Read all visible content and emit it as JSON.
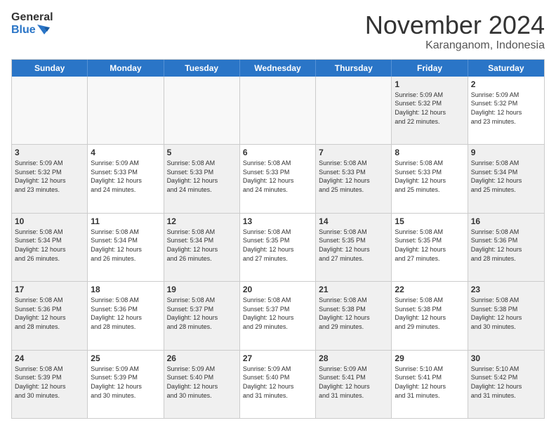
{
  "logo": {
    "line1": "General",
    "line2": "Blue"
  },
  "title": "November 2024",
  "location": "Karanganom, Indonesia",
  "days_header": [
    "Sunday",
    "Monday",
    "Tuesday",
    "Wednesday",
    "Thursday",
    "Friday",
    "Saturday"
  ],
  "weeks": [
    [
      {
        "day": "",
        "text": "",
        "empty": true
      },
      {
        "day": "",
        "text": "",
        "empty": true
      },
      {
        "day": "",
        "text": "",
        "empty": true
      },
      {
        "day": "",
        "text": "",
        "empty": true
      },
      {
        "day": "",
        "text": "",
        "empty": true
      },
      {
        "day": "1",
        "text": "Sunrise: 5:09 AM\nSunset: 5:32 PM\nDaylight: 12 hours\nand 22 minutes.",
        "shaded": true
      },
      {
        "day": "2",
        "text": "Sunrise: 5:09 AM\nSunset: 5:32 PM\nDaylight: 12 hours\nand 23 minutes.",
        "shaded": false
      }
    ],
    [
      {
        "day": "3",
        "text": "Sunrise: 5:09 AM\nSunset: 5:32 PM\nDaylight: 12 hours\nand 23 minutes.",
        "shaded": true
      },
      {
        "day": "4",
        "text": "Sunrise: 5:09 AM\nSunset: 5:33 PM\nDaylight: 12 hours\nand 24 minutes.",
        "shaded": false
      },
      {
        "day": "5",
        "text": "Sunrise: 5:08 AM\nSunset: 5:33 PM\nDaylight: 12 hours\nand 24 minutes.",
        "shaded": true
      },
      {
        "day": "6",
        "text": "Sunrise: 5:08 AM\nSunset: 5:33 PM\nDaylight: 12 hours\nand 24 minutes.",
        "shaded": false
      },
      {
        "day": "7",
        "text": "Sunrise: 5:08 AM\nSunset: 5:33 PM\nDaylight: 12 hours\nand 25 minutes.",
        "shaded": true
      },
      {
        "day": "8",
        "text": "Sunrise: 5:08 AM\nSunset: 5:33 PM\nDaylight: 12 hours\nand 25 minutes.",
        "shaded": false
      },
      {
        "day": "9",
        "text": "Sunrise: 5:08 AM\nSunset: 5:34 PM\nDaylight: 12 hours\nand 25 minutes.",
        "shaded": true
      }
    ],
    [
      {
        "day": "10",
        "text": "Sunrise: 5:08 AM\nSunset: 5:34 PM\nDaylight: 12 hours\nand 26 minutes.",
        "shaded": true
      },
      {
        "day": "11",
        "text": "Sunrise: 5:08 AM\nSunset: 5:34 PM\nDaylight: 12 hours\nand 26 minutes.",
        "shaded": false
      },
      {
        "day": "12",
        "text": "Sunrise: 5:08 AM\nSunset: 5:34 PM\nDaylight: 12 hours\nand 26 minutes.",
        "shaded": true
      },
      {
        "day": "13",
        "text": "Sunrise: 5:08 AM\nSunset: 5:35 PM\nDaylight: 12 hours\nand 27 minutes.",
        "shaded": false
      },
      {
        "day": "14",
        "text": "Sunrise: 5:08 AM\nSunset: 5:35 PM\nDaylight: 12 hours\nand 27 minutes.",
        "shaded": true
      },
      {
        "day": "15",
        "text": "Sunrise: 5:08 AM\nSunset: 5:35 PM\nDaylight: 12 hours\nand 27 minutes.",
        "shaded": false
      },
      {
        "day": "16",
        "text": "Sunrise: 5:08 AM\nSunset: 5:36 PM\nDaylight: 12 hours\nand 28 minutes.",
        "shaded": true
      }
    ],
    [
      {
        "day": "17",
        "text": "Sunrise: 5:08 AM\nSunset: 5:36 PM\nDaylight: 12 hours\nand 28 minutes.",
        "shaded": true
      },
      {
        "day": "18",
        "text": "Sunrise: 5:08 AM\nSunset: 5:36 PM\nDaylight: 12 hours\nand 28 minutes.",
        "shaded": false
      },
      {
        "day": "19",
        "text": "Sunrise: 5:08 AM\nSunset: 5:37 PM\nDaylight: 12 hours\nand 28 minutes.",
        "shaded": true
      },
      {
        "day": "20",
        "text": "Sunrise: 5:08 AM\nSunset: 5:37 PM\nDaylight: 12 hours\nand 29 minutes.",
        "shaded": false
      },
      {
        "day": "21",
        "text": "Sunrise: 5:08 AM\nSunset: 5:38 PM\nDaylight: 12 hours\nand 29 minutes.",
        "shaded": true
      },
      {
        "day": "22",
        "text": "Sunrise: 5:08 AM\nSunset: 5:38 PM\nDaylight: 12 hours\nand 29 minutes.",
        "shaded": false
      },
      {
        "day": "23",
        "text": "Sunrise: 5:08 AM\nSunset: 5:38 PM\nDaylight: 12 hours\nand 30 minutes.",
        "shaded": true
      }
    ],
    [
      {
        "day": "24",
        "text": "Sunrise: 5:08 AM\nSunset: 5:39 PM\nDaylight: 12 hours\nand 30 minutes.",
        "shaded": true
      },
      {
        "day": "25",
        "text": "Sunrise: 5:09 AM\nSunset: 5:39 PM\nDaylight: 12 hours\nand 30 minutes.",
        "shaded": false
      },
      {
        "day": "26",
        "text": "Sunrise: 5:09 AM\nSunset: 5:40 PM\nDaylight: 12 hours\nand 30 minutes.",
        "shaded": true
      },
      {
        "day": "27",
        "text": "Sunrise: 5:09 AM\nSunset: 5:40 PM\nDaylight: 12 hours\nand 31 minutes.",
        "shaded": false
      },
      {
        "day": "28",
        "text": "Sunrise: 5:09 AM\nSunset: 5:41 PM\nDaylight: 12 hours\nand 31 minutes.",
        "shaded": true
      },
      {
        "day": "29",
        "text": "Sunrise: 5:10 AM\nSunset: 5:41 PM\nDaylight: 12 hours\nand 31 minutes.",
        "shaded": false
      },
      {
        "day": "30",
        "text": "Sunrise: 5:10 AM\nSunset: 5:42 PM\nDaylight: 12 hours\nand 31 minutes.",
        "shaded": true
      }
    ]
  ]
}
